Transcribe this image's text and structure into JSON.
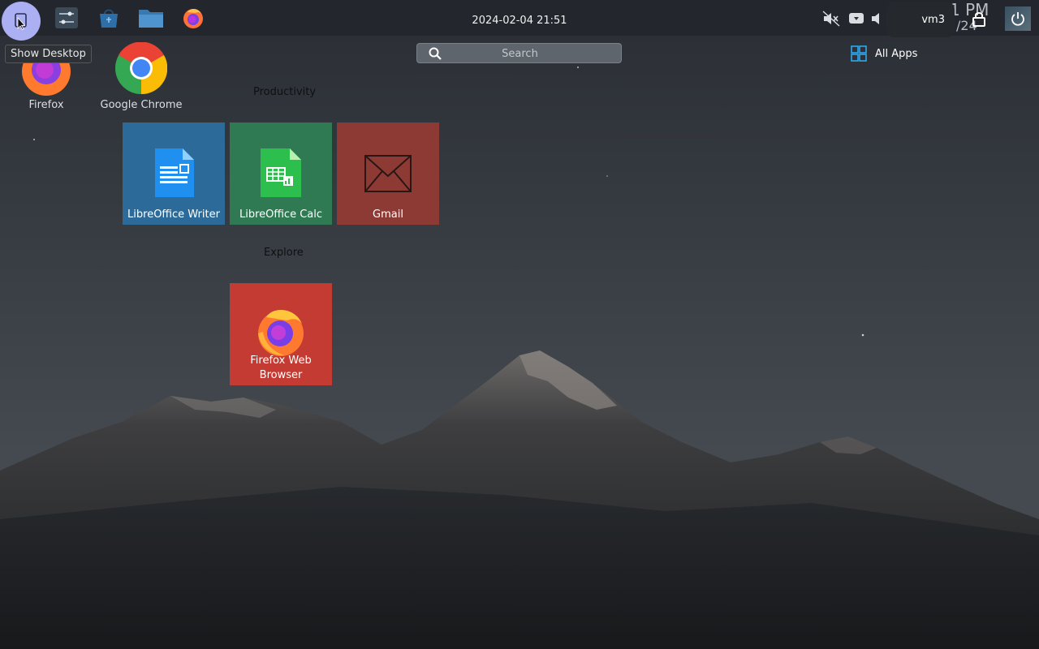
{
  "tooltip": {
    "show_desktop": "Show Desktop"
  },
  "taskbar": {
    "clock": "2024-02-04 21:51",
    "user": "vm3",
    "ghost_time": "1 PM",
    "ghost_date": "/24",
    "icons": [
      "show-desktop-icon",
      "system-settings-icon",
      "software-store-icon",
      "file-manager-icon",
      "firefox-icon"
    ],
    "tray": [
      "speaker-muted-icon",
      "media-tray-icon",
      "volume-icon",
      "lock-icon",
      "power-icon"
    ]
  },
  "search": {
    "placeholder": "Search"
  },
  "all_apps": {
    "label": "All Apps"
  },
  "desktop_icons": [
    {
      "label": "Firefox"
    },
    {
      "label": "Google Chrome"
    }
  ],
  "sections": {
    "productivity": "Productivity",
    "explore": "Explore"
  },
  "tiles": {
    "writer": {
      "label": "LibreOffice Writer",
      "color": "#2c6b99"
    },
    "calc": {
      "label": "LibreOffice Calc",
      "color": "#2f7a53"
    },
    "gmail": {
      "label": "Gmail",
      "color": "#8e3a34"
    },
    "firefox": {
      "label_line1": "Firefox Web",
      "label_line2": "Browser",
      "color": "#c33b32"
    }
  }
}
